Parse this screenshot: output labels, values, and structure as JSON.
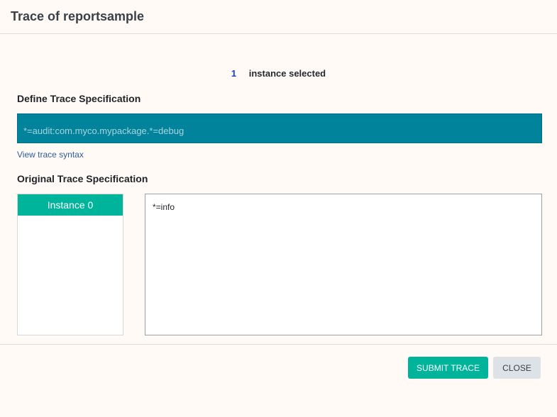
{
  "dialog": {
    "title": "Trace of reportsample"
  },
  "selection": {
    "count": "1",
    "label": "instance selected"
  },
  "define_section": {
    "heading": "Define Trace Specification",
    "input_value": "*=audit:com.myco.mypackage.*=debug",
    "syntax_link": "View trace syntax"
  },
  "original_section": {
    "heading": "Original Trace Specification",
    "instances": [
      {
        "label": "Instance 0"
      }
    ],
    "spec_text": "*=info"
  },
  "footer": {
    "submit_label": "SUBMIT TRACE",
    "close_label": "CLOSE"
  },
  "colors": {
    "accent": "#00b39b",
    "input_background": "#00839b",
    "count_blue": "#1a3fc7",
    "link": "#2d5e9c",
    "background": "#fffaf5"
  }
}
